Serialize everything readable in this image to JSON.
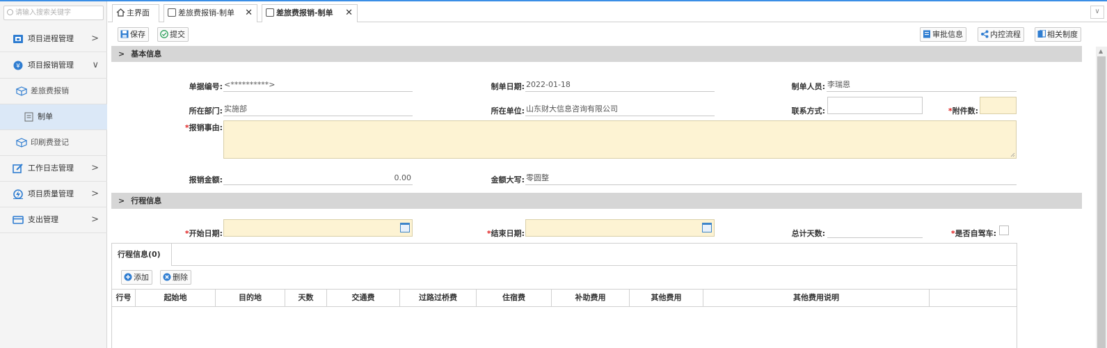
{
  "sidebar": {
    "search_placeholder": "请输入搜索关键字",
    "items": [
      {
        "label": "项目进程管理",
        "arrow": ">"
      },
      {
        "label": "项目报销管理",
        "arrow": "∨"
      },
      {
        "label": "差旅费报销"
      },
      {
        "label": "制单"
      },
      {
        "label": "印刷费登记"
      },
      {
        "label": "工作日志管理",
        "arrow": ">"
      },
      {
        "label": "项目质量管理",
        "arrow": ">"
      },
      {
        "label": "支出管理",
        "arrow": ">"
      }
    ]
  },
  "tabs": [
    {
      "label": "主界面"
    },
    {
      "label": "差旅费报销-制单",
      "close": "✕"
    },
    {
      "label": "差旅费报销-制单",
      "close": "✕"
    }
  ],
  "tabbar": {
    "dropdown": "∨"
  },
  "toolbar": {
    "save": "保存",
    "submit": "提交",
    "approval_info": "审批信息",
    "internal_flow": "内控流程",
    "related_rules": "相关制度"
  },
  "basic": {
    "section_title": "基本信息",
    "doc_no_label": "单据编号:",
    "doc_no": "<**********>",
    "date_label": "制单日期:",
    "date": "2022-01-18",
    "creator_label": "制单人员:",
    "creator": "李瑞恩",
    "dept_label": "所在部门:",
    "dept": "实施部",
    "unit_label": "所在单位:",
    "unit": "山东财大信息咨询有限公司",
    "contact_label": "联系方式:",
    "attach_label": "附件数:",
    "reason_label": "报销事由:",
    "amount_label": "报销金额:",
    "amount": "0.00",
    "amount_upper_label": "金额大写:",
    "amount_upper": "零圆整",
    "required_mark": "*"
  },
  "trip": {
    "section_title": "行程信息",
    "start_label": "开始日期:",
    "end_label": "结束日期:",
    "total_days_label": "总计天数:",
    "self_drive_label": "是否自驾车:",
    "grid_tab": "行程信息(0)",
    "add": "添加",
    "delete": "删除",
    "columns": [
      "行号",
      "起始地",
      "目的地",
      "天数",
      "交通费",
      "过路过桥费",
      "住宿费",
      "补助费用",
      "其他费用",
      "其他费用说明"
    ]
  },
  "colors": {
    "accent": "#3a8ee6",
    "required": "#e02020",
    "highlight_input": "#fdf3d3",
    "section_bar": "#d6d6d6",
    "active_nav": "#dbe8f7"
  }
}
